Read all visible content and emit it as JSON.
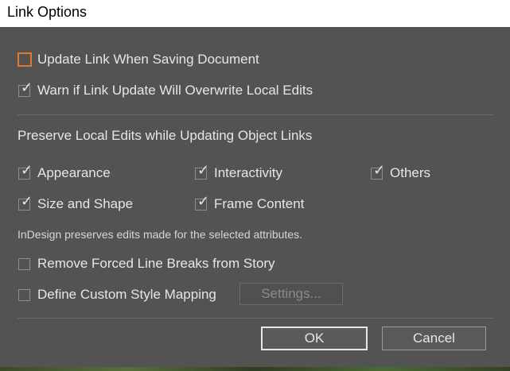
{
  "window": {
    "title": "Link Options"
  },
  "options": {
    "update_link": {
      "label": "Update Link When Saving Document",
      "checked": false
    },
    "warn_overwrite": {
      "label": "Warn if Link Update Will Overwrite Local Edits",
      "checked": true
    }
  },
  "preserve": {
    "title": "Preserve Local Edits while Updating Object Links",
    "appearance": {
      "label": "Appearance",
      "checked": true
    },
    "interactivity": {
      "label": "Interactivity",
      "checked": true
    },
    "others": {
      "label": "Others",
      "checked": true
    },
    "size_shape": {
      "label": "Size and Shape",
      "checked": true
    },
    "frame_content": {
      "label": "Frame Content",
      "checked": true
    },
    "note": "InDesign preserves edits made for the selected attributes."
  },
  "extra": {
    "remove_breaks": {
      "label": "Remove Forced Line Breaks from Story",
      "checked": false
    },
    "custom_style": {
      "label": "Define Custom Style Mapping",
      "checked": false
    },
    "settings_label": "Settings..."
  },
  "buttons": {
    "ok": "OK",
    "cancel": "Cancel"
  },
  "colors": {
    "dialog_bg": "#535353",
    "focus_accent": "#e07a2a",
    "text": "#e6e6e6"
  }
}
